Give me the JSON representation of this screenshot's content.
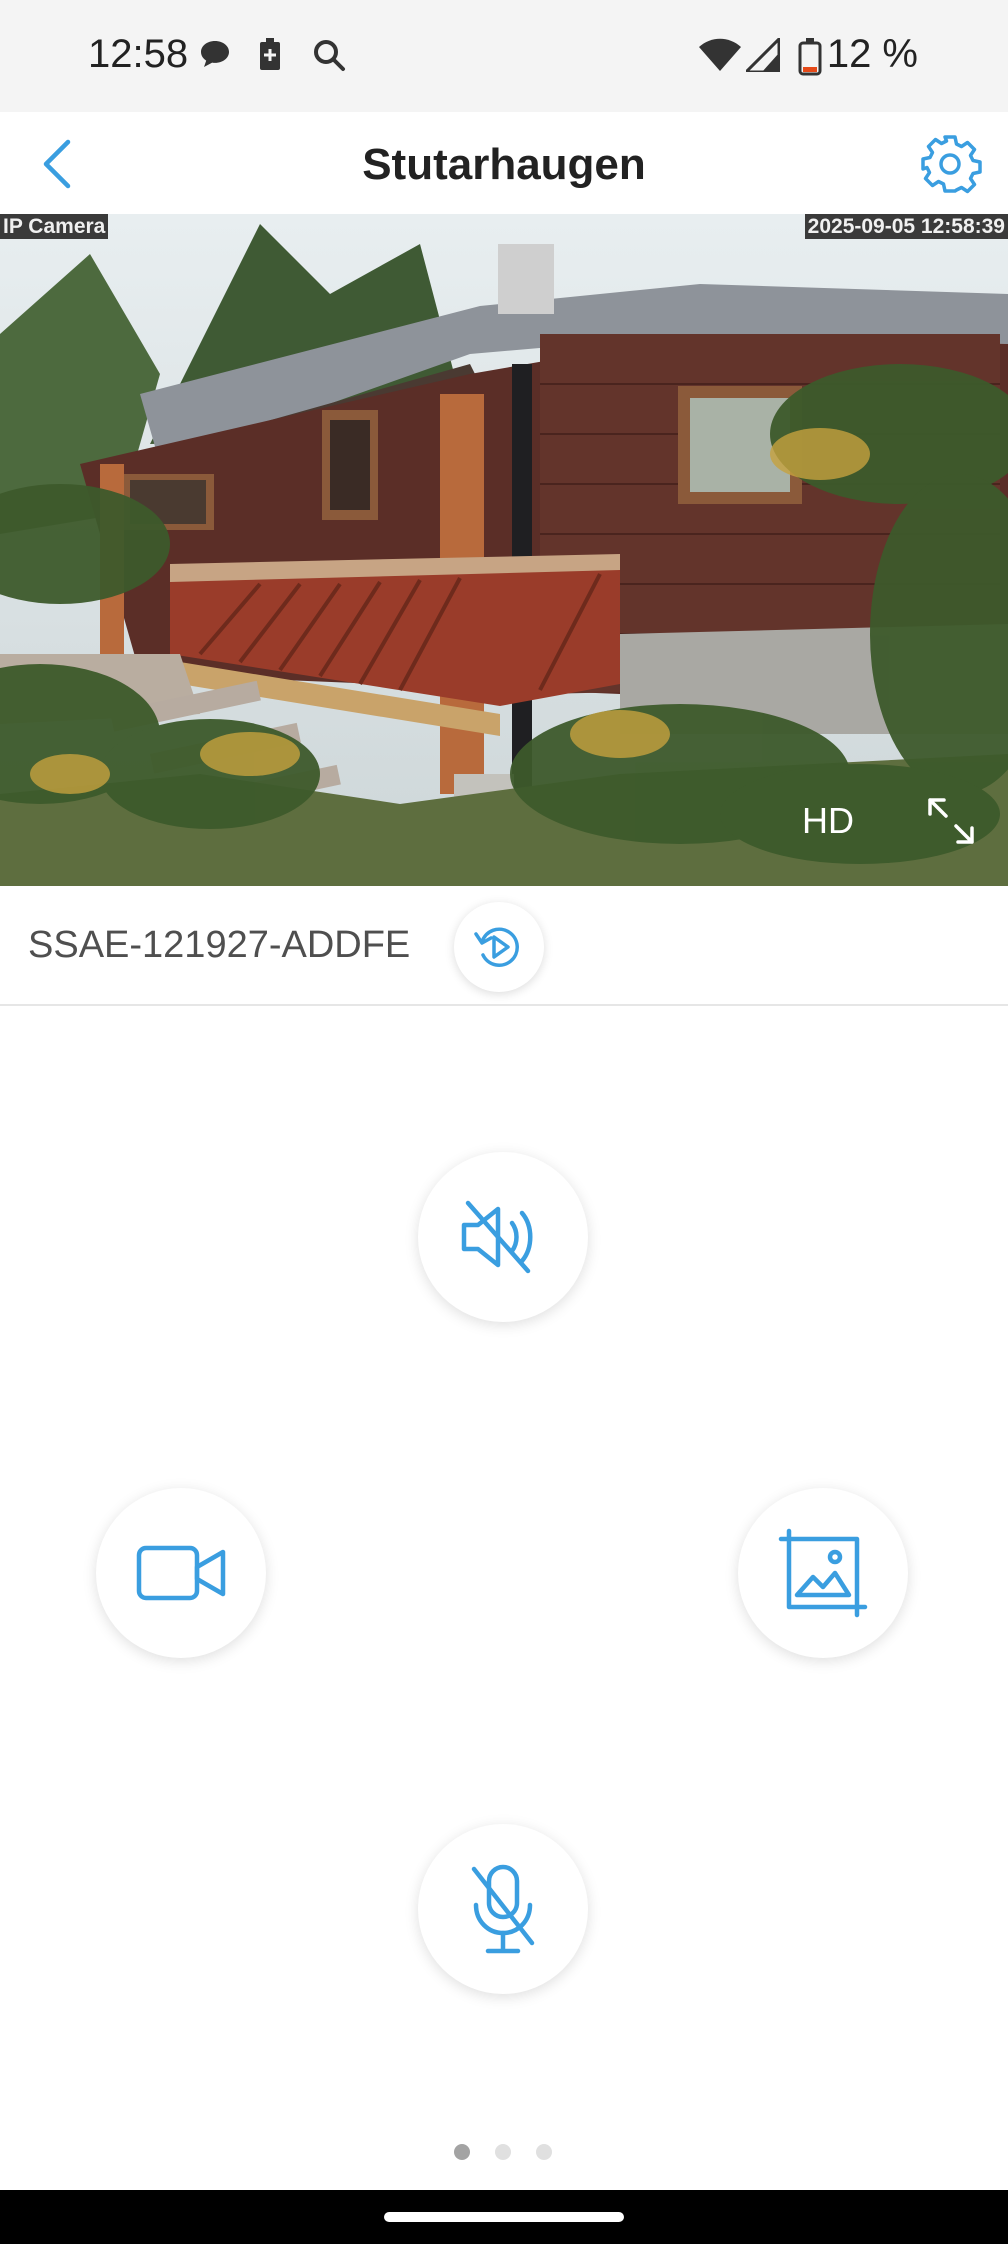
{
  "status_bar": {
    "time": "12:58",
    "left_icons": [
      "chat-bubble-icon",
      "battery-saver-icon",
      "search-icon"
    ],
    "right_icons": [
      "wifi-icon",
      "cell-signal-icon",
      "battery-low-icon"
    ],
    "battery_percent": "12 %"
  },
  "header": {
    "title": "Stutarhaugen",
    "back_icon": "chevron-left-icon",
    "settings_icon": "gear-icon"
  },
  "video": {
    "camera_label": "IP Camera",
    "timestamp": "2025-09-05 12:58:39",
    "quality_label": "HD",
    "fullscreen_icon": "expand-icon"
  },
  "device": {
    "id": "SSAE-121927-ADDFE",
    "playback_icon": "replay-play-icon"
  },
  "controls": {
    "speaker_icon": "speaker-muted-icon",
    "record_icon": "video-camera-icon",
    "snapshot_icon": "image-crop-icon",
    "mic_icon": "microphone-muted-icon"
  },
  "pager": {
    "pages": 3,
    "active": 1
  },
  "colors": {
    "accent": "#3a9ee0",
    "title": "#222222",
    "text_muted": "#4f4f4f"
  }
}
